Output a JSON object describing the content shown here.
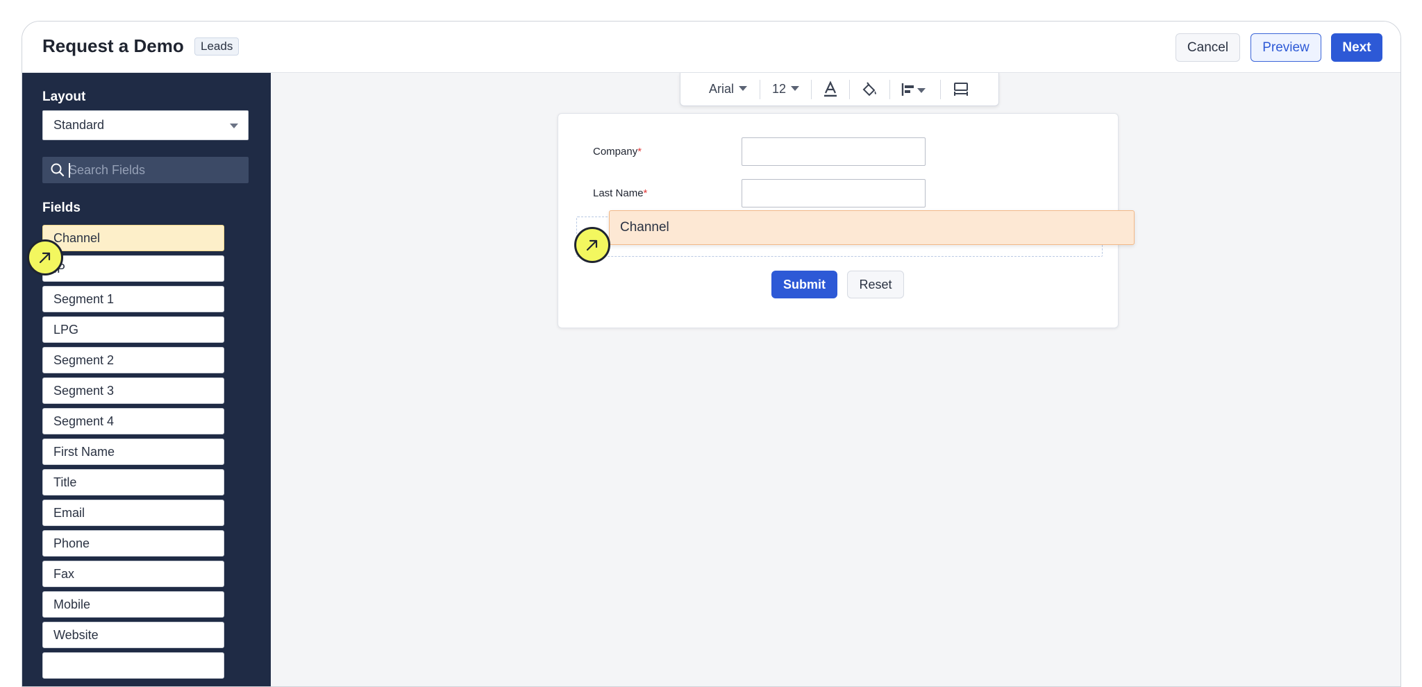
{
  "header": {
    "title": "Request a Demo",
    "module_tag": "Leads",
    "cancel_label": "Cancel",
    "preview_label": "Preview",
    "next_label": "Next"
  },
  "sidebar": {
    "layout_heading": "Layout",
    "layout_value": "Standard",
    "search_placeholder": "Search Fields",
    "fields_heading": "Fields",
    "fields": [
      "Channel",
      "IP",
      "Segment 1",
      "LPG",
      "Segment 2",
      "Segment 3",
      "Segment 4",
      "First Name",
      "Title",
      "Email",
      "Phone",
      "Fax",
      "Mobile",
      "Website"
    ]
  },
  "toolbar": {
    "font_family": "Arial",
    "font_size": "12"
  },
  "form": {
    "company_label": "Company",
    "last_name_label": "Last Name",
    "required_mark": "*",
    "submit_label": "Submit",
    "reset_label": "Reset"
  },
  "drag": {
    "label": "Channel"
  },
  "colors": {
    "sidebar_bg": "#1f2b45",
    "accent": "#2d59d6",
    "highlight": "#fdefc9",
    "drag_ghost": "#fde8d4",
    "cursor": "#f3f75f"
  }
}
